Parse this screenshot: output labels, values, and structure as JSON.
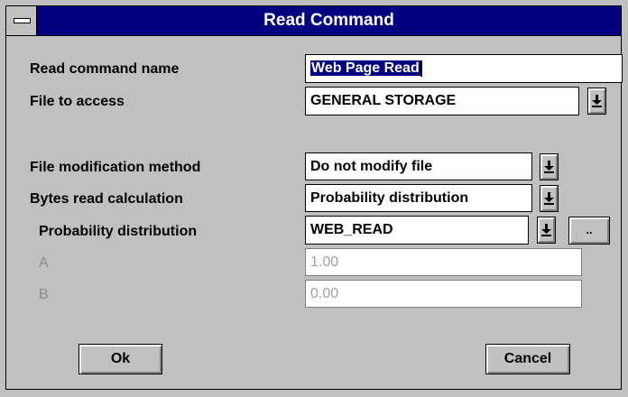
{
  "window": {
    "title": "Read Command"
  },
  "form": {
    "read_command_name": {
      "label": "Read command name",
      "value": "Web Page Read"
    },
    "file_to_access": {
      "label": "File to access",
      "value": "GENERAL STORAGE"
    },
    "file_modification_method": {
      "label": "File modification method",
      "value": "Do not modify file"
    },
    "bytes_read_calculation": {
      "label": "Bytes read calculation",
      "value": "Probability distribution"
    },
    "probability_distribution": {
      "label": "Probability distribution",
      "value": "WEB_READ",
      "browse_label": ".."
    },
    "param_a": {
      "label": "A",
      "value": "1.00"
    },
    "param_b": {
      "label": "B",
      "value": "0.00"
    }
  },
  "buttons": {
    "ok_label": "Ok",
    "cancel_label": "Cancel"
  },
  "colors": {
    "titlebar": "#000080",
    "dialog_bg": "#c0c0c0",
    "selection": "#000080",
    "disabled_text": "#a0a0a0"
  },
  "icons": {
    "dropdown": "arrow-down-to-bar-icon",
    "system_menu": "system-menu-icon"
  }
}
